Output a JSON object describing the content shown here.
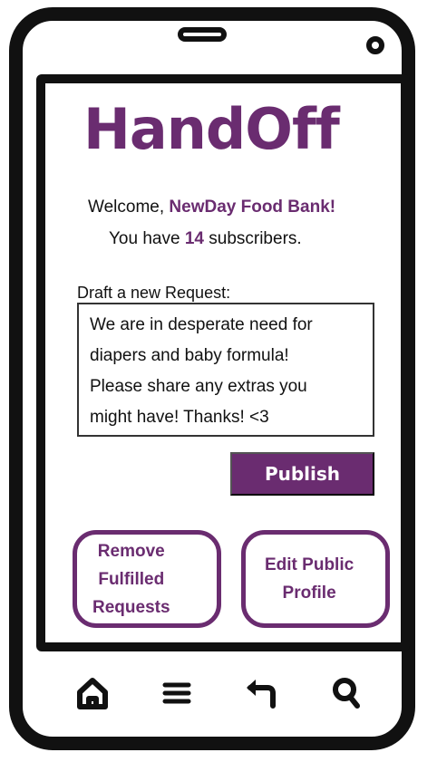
{
  "app": {
    "title": "HandOff"
  },
  "welcome": {
    "prefix": "Welcome, ",
    "organization": "NewDay Food Bank!",
    "subscribers_prefix": "You have ",
    "subscriber_count": "14",
    "subscribers_suffix": " subscribers."
  },
  "draft": {
    "label": "Draft a new Request:",
    "value": "We are in desperate need for\ndiapers and baby formula!\nPlease share any extras you\nmight have! Thanks! <3"
  },
  "buttons": {
    "publish_label": "Publish",
    "remove_label": "Remove\nFulfilled\nRequests",
    "edit_label": "Edit Public\nProfile"
  },
  "navigation": [
    {
      "icon": "home-icon"
    },
    {
      "icon": "menu-icon"
    },
    {
      "icon": "back-icon"
    },
    {
      "icon": "search-icon"
    }
  ],
  "colors": {
    "accent": "#6a2c70",
    "device": "#111111",
    "background": "#ffffff"
  }
}
